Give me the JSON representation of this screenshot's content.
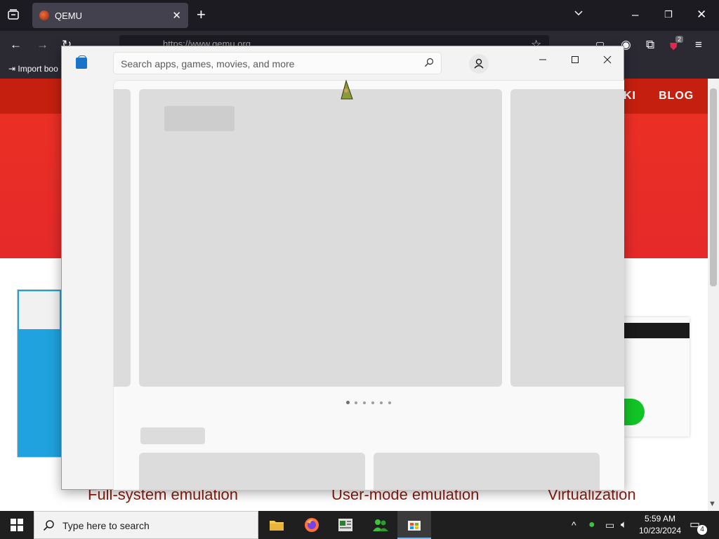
{
  "browser": {
    "tab_title": "QEMU",
    "url_text": "https://www.qemu.org",
    "bookmark_label": "Import boo",
    "extension_badge": "2"
  },
  "website": {
    "nav_items": [
      "KI",
      "BLOG"
    ],
    "features": [
      "Full-system emulation",
      "User-mode emulation",
      "Virtualization"
    ]
  },
  "store": {
    "search_placeholder": "Search apps, games, movies, and more",
    "carousel_dots": 6,
    "active_dot": 0
  },
  "taskbar": {
    "search_placeholder": "Type here to search",
    "time": "5:59 AM",
    "date": "10/23/2024",
    "notification_count": "4"
  }
}
